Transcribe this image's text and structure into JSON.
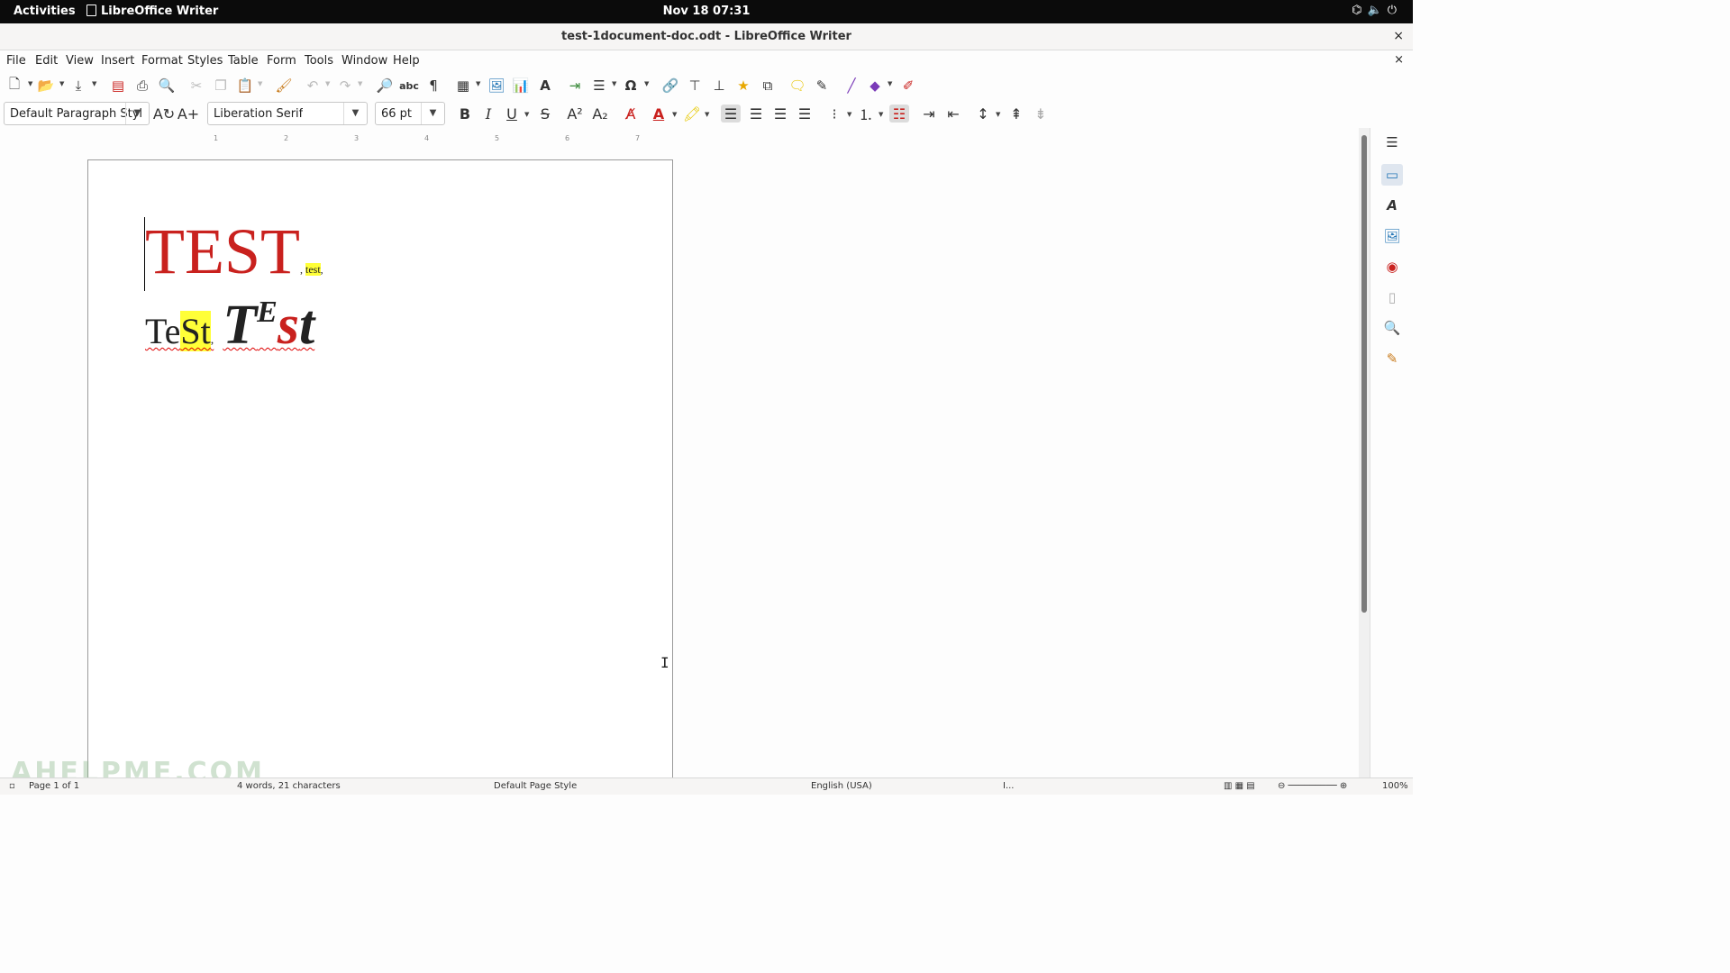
{
  "topbar": {
    "activities": "Activities",
    "app_name": "LibreOffice Writer",
    "clock": "Nov 18  07:31",
    "tray_icons": [
      "network-icon",
      "volume-icon",
      "power-icon"
    ]
  },
  "window": {
    "title": "test-1document-doc.odt - LibreOffice Writer",
    "close": "×"
  },
  "menu": {
    "file": "File",
    "edit": "Edit",
    "view": "View",
    "insert": "Insert",
    "format": "Format",
    "styles": "Styles",
    "table": "Table",
    "form": "Form",
    "tools": "Tools",
    "window": "Window",
    "help": "Help",
    "doc_close": "×"
  },
  "formatting": {
    "paragraph_style": "Default Paragraph Styl",
    "font_name": "Liberation Serif",
    "font_size": "66 pt"
  },
  "ruler": {
    "ticks": [
      "1",
      "2",
      "3",
      "4",
      "5",
      "6",
      "7"
    ]
  },
  "document": {
    "line1_big": "TEST",
    "line1_comma1": ", ",
    "line1_small": "test",
    "line1_comma2": ",",
    "line2_te": "Te",
    "line2_st": "St",
    "line2_comma": ",",
    "line2_T": "T",
    "line2_E": "E",
    "line2_s": "s",
    "line2_t": "t"
  },
  "statusbar": {
    "page": "Page 1 of 1",
    "words": "4 words, 21 characters",
    "page_style": "Default Page Style",
    "language": "English (USA)",
    "insert_mode": "I...",
    "zoom": "100%"
  },
  "watermark": "AHELPME.COM",
  "colors": {
    "accent_red": "#c9211e",
    "highlight": "#ffff38"
  }
}
